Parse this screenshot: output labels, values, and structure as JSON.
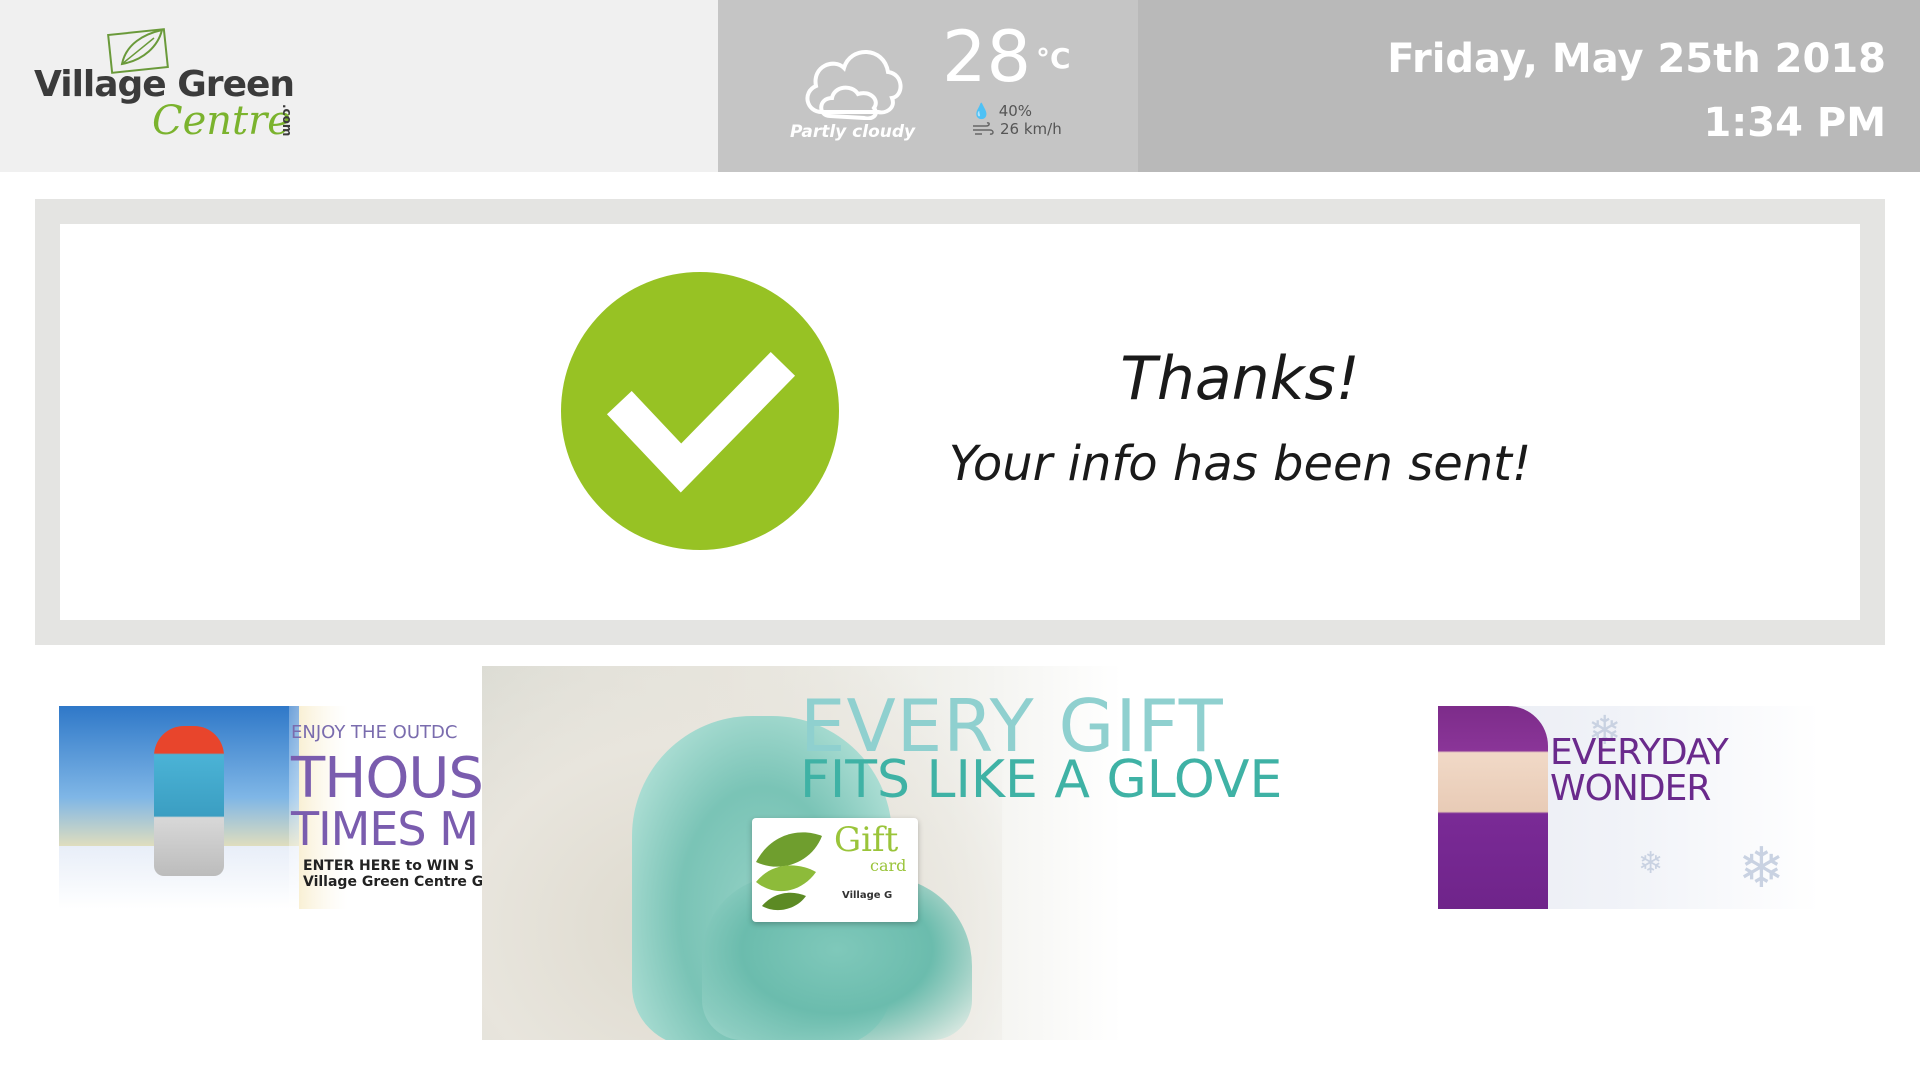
{
  "brand": {
    "name": "Village Green",
    "script": "Centre",
    "suffix": ".com"
  },
  "weather": {
    "icon": "cloud-icon",
    "description": "Partly cloudy",
    "temperature": "28",
    "unit": "°C",
    "humidity": "40%",
    "wind": "26 km/h"
  },
  "datetime": {
    "date": "Friday, May 25th 2018",
    "time": "1:34 PM"
  },
  "confirmation": {
    "icon": "checkmark-icon",
    "title": "Thanks!",
    "message": "Your info has been sent!",
    "accent_color": "#97c224"
  },
  "banners": {
    "left": {
      "line1": "ENJOY THE OUTDC",
      "line2": "THOUS",
      "line3": "TIMES M",
      "line4": "ENTER HERE to WIN S",
      "line5": "Village Green Centre Gi"
    },
    "center": {
      "line1": "EVERY GIFT",
      "line2": "FITS LIKE A GLOVE",
      "card_word": "Gift",
      "card_sub": "card",
      "card_brand": "Village G"
    },
    "right": {
      "line1": "EVERYDAY",
      "line2": "WONDER"
    }
  }
}
